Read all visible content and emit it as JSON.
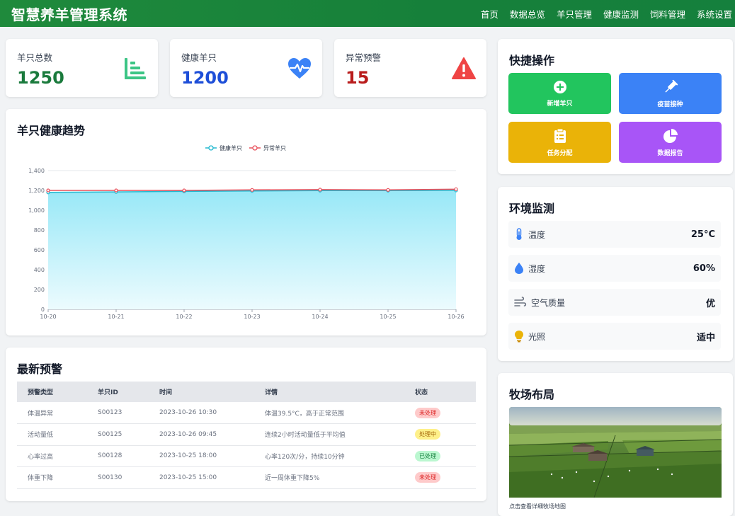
{
  "header": {
    "title": "智慧养羊管理系统",
    "nav": [
      "首页",
      "数据总览",
      "羊只管理",
      "健康监测",
      "饲料管理",
      "系统设置"
    ]
  },
  "stats": [
    {
      "label": "羊只总数",
      "value": "1250",
      "color": "#1a7a3c",
      "icon": "bar-chart-icon"
    },
    {
      "label": "健康羊只",
      "value": "1200",
      "color": "#1d4ed8",
      "icon": "heartbeat-icon"
    },
    {
      "label": "异常预警",
      "value": "15",
      "color": "#b91c1c",
      "icon": "warning-icon"
    }
  ],
  "trend": {
    "title": "羊只健康趋势"
  },
  "chart_data": {
    "type": "line",
    "categories": [
      "10-20",
      "10-21",
      "10-22",
      "10-23",
      "10-24",
      "10-25",
      "10-26"
    ],
    "series": [
      {
        "name": "健康羊只",
        "values": [
          1180,
          1185,
          1190,
          1195,
          1198,
          1198,
          1200
        ],
        "color": "#22b8cf"
      },
      {
        "name": "异常羊只",
        "values": [
          1200,
          1200,
          1200,
          1205,
          1208,
          1205,
          1212
        ],
        "color": "#e8505b"
      }
    ],
    "ylim": [
      0,
      1400
    ],
    "yticks": [
      "0",
      "200",
      "400",
      "600",
      "800",
      "1,000",
      "1,200",
      "1,400"
    ],
    "legend": "top-center",
    "grid": true
  },
  "alerts": {
    "title": "最新预警",
    "columns": [
      "预警类型",
      "羊只ID",
      "时间",
      "详情",
      "状态"
    ],
    "rows": [
      {
        "type": "体温异常",
        "id": "S00123",
        "time": "2023-10-26 10:30",
        "detail": "体温39.5°C，高于正常范围",
        "status": "未处理",
        "status_kind": "red"
      },
      {
        "type": "活动量低",
        "id": "S00125",
        "time": "2023-10-26 09:45",
        "detail": "连续2小时活动量低于平均值",
        "status": "处理中",
        "status_kind": "yellow"
      },
      {
        "type": "心率过高",
        "id": "S00128",
        "time": "2023-10-25 18:00",
        "detail": "心率120次/分，持续10分钟",
        "status": "已处理",
        "status_kind": "green"
      },
      {
        "type": "体重下降",
        "id": "S00130",
        "time": "2023-10-25 15:00",
        "detail": "近一周体重下降5%",
        "status": "未处理",
        "status_kind": "red"
      }
    ]
  },
  "quick": {
    "title": "快捷操作",
    "buttons": [
      {
        "label": "新增羊只",
        "color": "#22c55e",
        "icon": "plus-circle-icon"
      },
      {
        "label": "疫苗接种",
        "color": "#3b82f6",
        "icon": "syringe-icon"
      },
      {
        "label": "任务分配",
        "color": "#eab308",
        "icon": "clipboard-icon"
      },
      {
        "label": "数据报告",
        "color": "#a855f7",
        "icon": "pie-chart-icon"
      }
    ]
  },
  "env": {
    "title": "环境监测",
    "items": [
      {
        "label": "温度",
        "value": "25°C",
        "icon": "thermometer-icon"
      },
      {
        "label": "湿度",
        "value": "60%",
        "icon": "water-drop-icon"
      },
      {
        "label": "空气质量",
        "value": "优",
        "icon": "wind-icon"
      },
      {
        "label": "光照",
        "value": "适中",
        "icon": "lightbulb-icon"
      }
    ]
  },
  "farm": {
    "title": "牧场布局",
    "caption": "点击查看详细牧场地图"
  }
}
